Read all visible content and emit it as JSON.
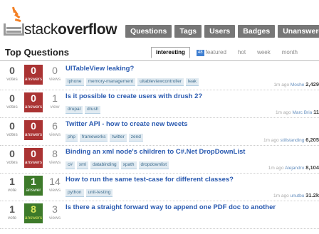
{
  "brand": {
    "prefix": "stack",
    "bold": "overflow"
  },
  "nav": [
    "Questions",
    "Tags",
    "Users",
    "Badges",
    "Unanswered"
  ],
  "section_title": "Top Questions",
  "sort_tabs": [
    {
      "label": "interesting",
      "active": true
    },
    {
      "label": "featured",
      "badge": "48",
      "active": false
    },
    {
      "label": "hot",
      "active": false
    },
    {
      "label": "week",
      "active": false
    },
    {
      "label": "month",
      "active": false
    }
  ],
  "labels": {
    "votes": "votes",
    "vote": "vote",
    "answers": "answers",
    "answer": "answer",
    "views": "views",
    "view": "view"
  },
  "questions": [
    {
      "votes": "0",
      "votes_label": "votes",
      "answers": "0",
      "answers_label": "answers",
      "views": "0",
      "views_label": "views",
      "title": "UITableView leaking?",
      "tags": [
        "iphone",
        "memory-management",
        "uitableviewcontroller",
        "leak"
      ],
      "time": "1m ago",
      "user": "Moshe",
      "rep": "2,429"
    },
    {
      "votes": "0",
      "votes_label": "votes",
      "answers": "0",
      "answers_label": "answers",
      "views": "1",
      "views_label": "view",
      "title": "Is it possible to create users with drush 2?",
      "tags": [
        "drupal",
        "drush"
      ],
      "time": "1m ago",
      "user": "Marc Bria",
      "rep": "11"
    },
    {
      "votes": "0",
      "votes_label": "votes",
      "answers": "0",
      "answers_label": "answers",
      "views": "6",
      "views_label": "views",
      "title": "Twitter API - how to create new tweets",
      "tags": [
        "php",
        "frameworks",
        "twitter",
        "zend"
      ],
      "time": "1m ago",
      "user": "stillstanding",
      "rep": "6,205"
    },
    {
      "votes": "0",
      "votes_label": "votes",
      "answers": "0",
      "answers_label": "answers",
      "views": "8",
      "views_label": "views",
      "title": "Binding an xml node's children to C#.Net DropDownList",
      "tags": [
        "c#",
        "xml",
        "databinding",
        "xpath",
        "dropdownlist"
      ],
      "time": "1m ago",
      "user": "Alejandro",
      "rep": "8,104"
    },
    {
      "votes": "1",
      "votes_label": "vote",
      "answers": "1",
      "answers_label": "answer",
      "views": "14",
      "views_label": "views",
      "title": "How to run the same test-case for different classes?",
      "tags": [
        "python",
        "unit-testing"
      ],
      "time": "1m ago",
      "user": "unutbu",
      "rep": "31.2k"
    },
    {
      "votes": "1",
      "votes_label": "vote",
      "answers": "8",
      "answers_label": "answers",
      "views": "3",
      "views_label": "views",
      "title": "Is there a straight forward way to append one PDF doc to another",
      "tags": [],
      "time": "",
      "user": "",
      "rep": ""
    }
  ]
}
